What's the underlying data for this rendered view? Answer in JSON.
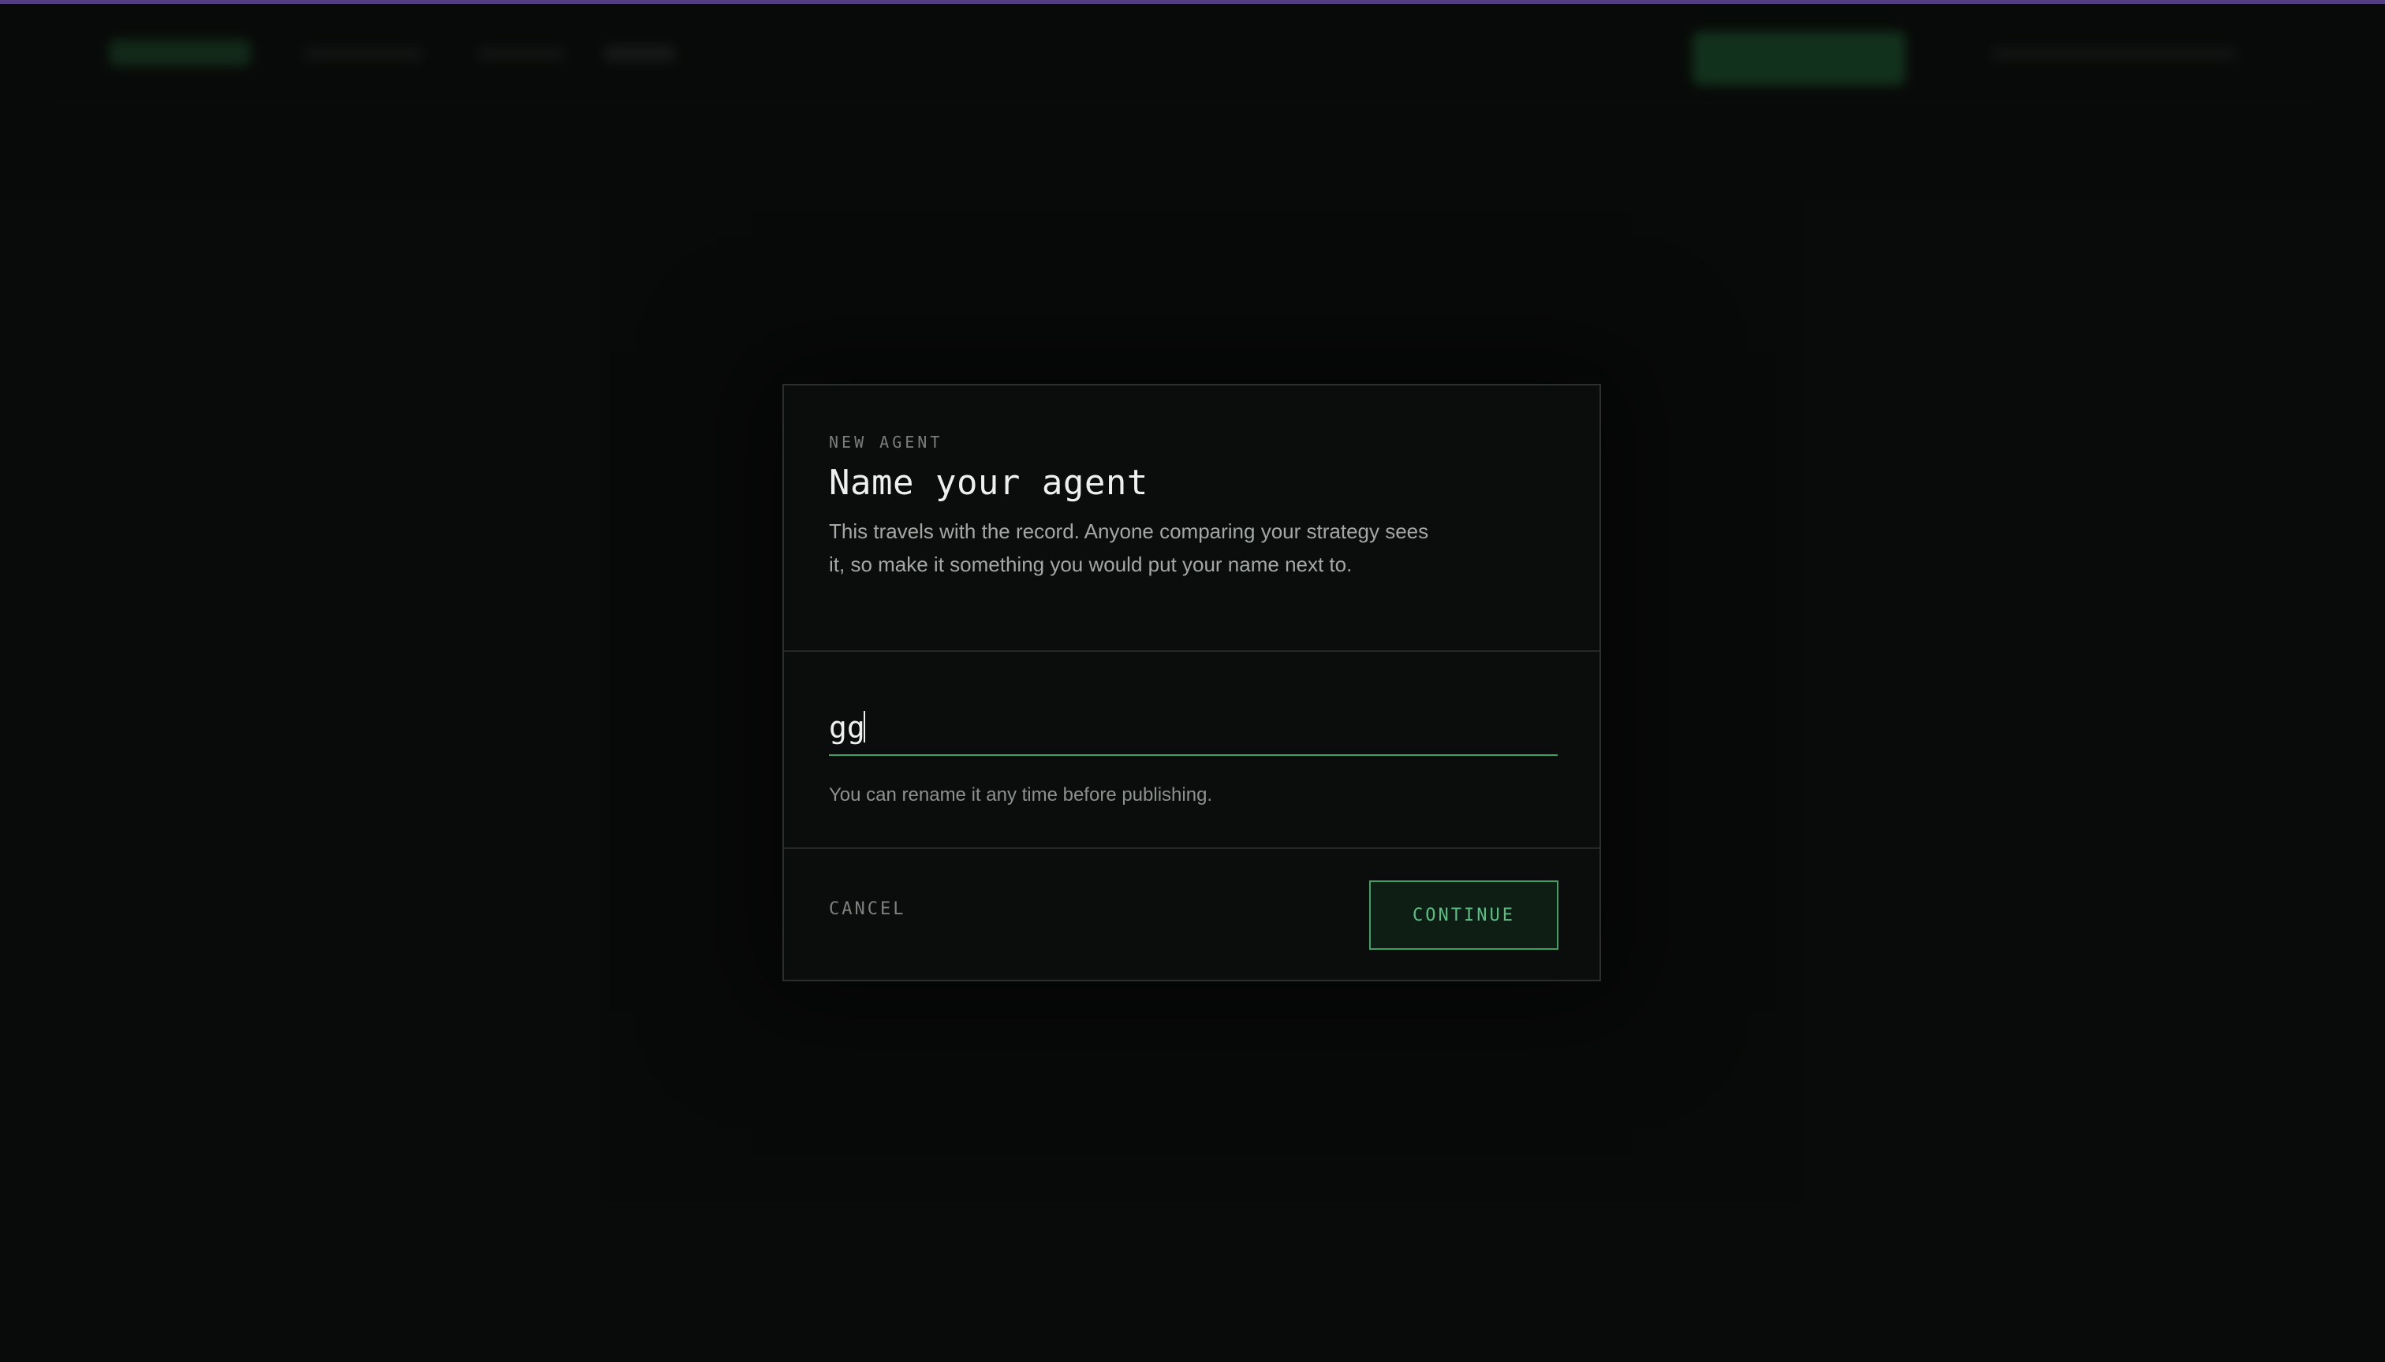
{
  "dialog": {
    "eyebrow": "NEW AGENT",
    "title": "Name your agent",
    "description": "This travels with the record. Anyone comparing your strategy sees it, so make it something you would put your name next to.",
    "name_input": {
      "value": "gg",
      "placeholder": ""
    },
    "hint": "You can rename it any time before publishing.",
    "cancel_label": "CANCEL",
    "continue_label": "CONTINUE"
  },
  "colors": {
    "background": "#0a0c0b",
    "accent_bar": "#7d5bc7",
    "accent_green": "#3fa066",
    "continue_text": "#58c083"
  }
}
